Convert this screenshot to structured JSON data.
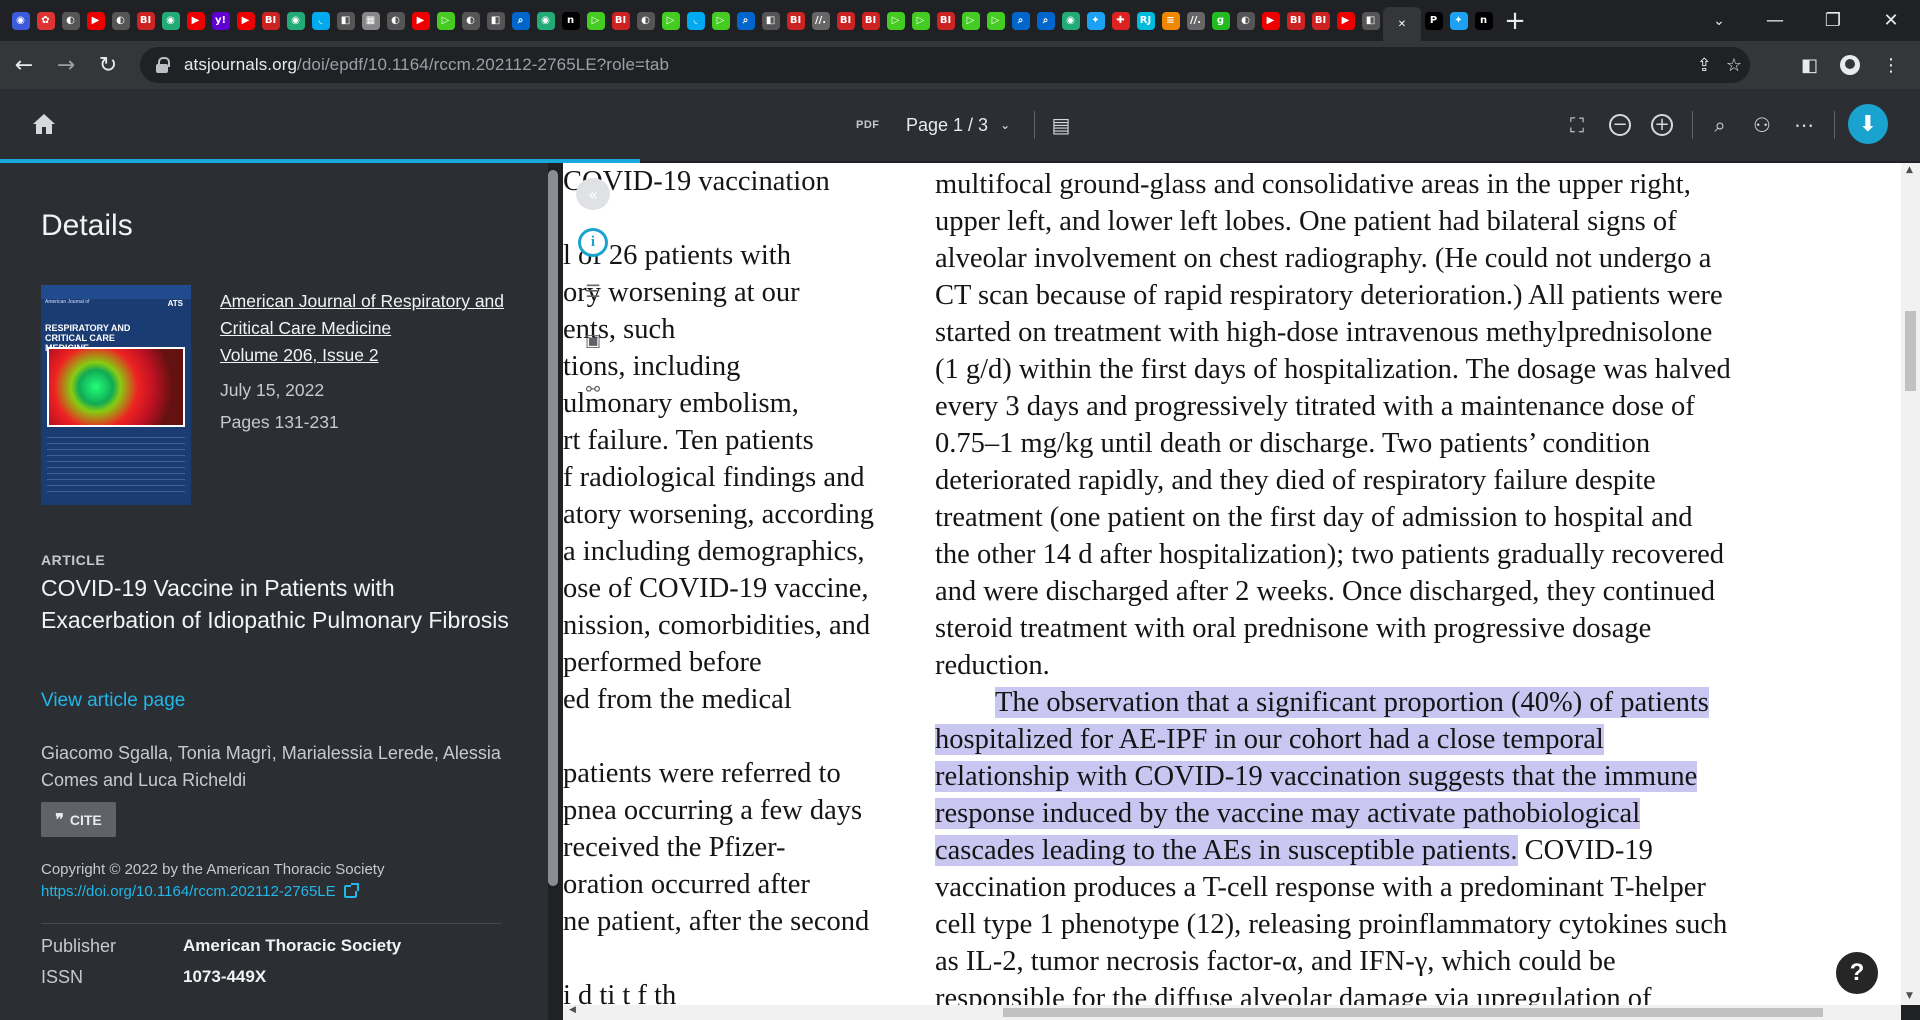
{
  "browser": {
    "tabs": [
      {
        "color": "#3b5bdb",
        "glyph": "◉"
      },
      {
        "color": "#d33",
        "glyph": "✿"
      },
      {
        "color": "#555",
        "glyph": "◐"
      },
      {
        "color": "#e00",
        "glyph": "▶"
      },
      {
        "color": "#555",
        "glyph": "◐"
      },
      {
        "color": "#c22",
        "glyph": "BI"
      },
      {
        "color": "#2a7",
        "glyph": "◉"
      },
      {
        "color": "#e00",
        "glyph": "▶"
      },
      {
        "color": "#6001d2",
        "glyph": "y!"
      },
      {
        "color": "#e00",
        "glyph": "▶"
      },
      {
        "color": "#c22",
        "glyph": "BI"
      },
      {
        "color": "#2a7",
        "glyph": "◉"
      },
      {
        "color": "#0ae",
        "glyph": "◟"
      },
      {
        "color": "#555",
        "glyph": "◧"
      },
      {
        "color": "#888",
        "glyph": "▦"
      },
      {
        "color": "#555",
        "glyph": "◐"
      },
      {
        "color": "#e00",
        "glyph": "▶"
      },
      {
        "color": "#4c2",
        "glyph": "▷"
      },
      {
        "color": "#555",
        "glyph": "◐"
      },
      {
        "color": "#555",
        "glyph": "◧"
      },
      {
        "color": "#06c",
        "glyph": "⌕"
      },
      {
        "color": "#2a7",
        "glyph": "◉"
      },
      {
        "color": "#000",
        "glyph": "n"
      },
      {
        "color": "#4c2",
        "glyph": "▷"
      },
      {
        "color": "#c22",
        "glyph": "BI"
      },
      {
        "color": "#555",
        "glyph": "◐"
      },
      {
        "color": "#4c2",
        "glyph": "▷"
      },
      {
        "color": "#0ae",
        "glyph": "◟"
      },
      {
        "color": "#4c2",
        "glyph": "▷"
      },
      {
        "color": "#06c",
        "glyph": "⌕"
      },
      {
        "color": "#555",
        "glyph": "◧"
      },
      {
        "color": "#c22",
        "glyph": "BI"
      },
      {
        "color": "#666",
        "glyph": "//."
      },
      {
        "color": "#c22",
        "glyph": "BI"
      },
      {
        "color": "#c22",
        "glyph": "BI"
      },
      {
        "color": "#4c2",
        "glyph": "▷"
      },
      {
        "color": "#4c2",
        "glyph": "▷"
      },
      {
        "color": "#c22",
        "glyph": "BI"
      },
      {
        "color": "#4c2",
        "glyph": "▷"
      },
      {
        "color": "#4c2",
        "glyph": "▷"
      },
      {
        "color": "#06c",
        "glyph": "⌕"
      },
      {
        "color": "#06c",
        "glyph": "⌕"
      },
      {
        "color": "#2a7",
        "glyph": "◉"
      },
      {
        "color": "#1da1f2",
        "glyph": "✦"
      },
      {
        "color": "#d22",
        "glyph": "✚"
      },
      {
        "color": "#0bd",
        "glyph": "RJ"
      },
      {
        "color": "#e80",
        "glyph": "≡"
      },
      {
        "color": "#666",
        "glyph": "//."
      },
      {
        "color": "#2b2",
        "glyph": "g"
      },
      {
        "color": "#555",
        "glyph": "◐"
      },
      {
        "color": "#e00",
        "glyph": "▶"
      },
      {
        "color": "#c22",
        "glyph": "BI"
      },
      {
        "color": "#c22",
        "glyph": "BI"
      },
      {
        "color": "#e00",
        "glyph": "▶"
      },
      {
        "color": "#555",
        "glyph": "◧"
      }
    ],
    "active_tab_close": "✕",
    "tabs_after": [
      {
        "color": "#000",
        "glyph": "P"
      },
      {
        "color": "#1da1f2",
        "glyph": "✦"
      },
      {
        "color": "#000",
        "glyph": "n"
      }
    ],
    "new_tab": "+",
    "url_domain": "atsjournals.org",
    "url_path": "/doi/epdf/10.1164/rccm.202112-2765LE?role=tab"
  },
  "viewer": {
    "pdf_tag": "PDF",
    "page_indicator": "Page 1 / 3",
    "accent": "#1aa3cf"
  },
  "details": {
    "heading": "Details",
    "cover": {
      "small_title": "American Journal of",
      "title_line1": "RESPIRATORY AND",
      "title_line2": "CRITICAL CARE MEDICINE",
      "logo": "ATS"
    },
    "journal_name_line1": "American Journal of Respiratory and",
    "journal_name_line2": "Critical Care Medicine",
    "volume": "Volume 206, Issue 2",
    "date": "July 15, 2022",
    "pages": "Pages  131-231",
    "article_label": "ARTICLE",
    "article_title": "COVID-19 Vaccine in Patients with Exacerbation of Idiopathic Pulmonary Fibrosis",
    "view_article": "View article page",
    "authors": "Giacomo Sgalla, Tonia Magrì, Marialessia Lerede, Alessia Comes and Luca Richeldi",
    "cite_label": "CITE",
    "copyright": "Copyright © 2022 by the American Thoracic Society",
    "doi_url": "https://doi.org/10.1164/rccm.202112-2765LE",
    "publisher_key": "Publisher",
    "publisher_value": "American Thoracic Society",
    "issn_key": "ISSN",
    "issn_value": "1073-449X"
  },
  "pdf": {
    "left_column": [
      "COVID-19 vaccination",
      "",
      "l of 26 patients with",
      "ory worsening at our",
      "ents, such",
      "tions, including",
      "ulmonary embolism,",
      "rt failure. Ten patients",
      "f radiological findings and",
      "atory worsening, according",
      "a including demographics,",
      "ose of COVID-19 vaccine,",
      "nission, comorbidities, and",
      "performed before",
      "ed from the medical",
      "",
      "patients were referred to",
      "pnea occurring a few days",
      "received the Pfizer-",
      "oration occurred after",
      "ne patient, after the second",
      "",
      "i  d  ti  t  f  th"
    ],
    "right_column": [
      "multifocal ground-glass and consolidative areas in the upper right,",
      "upper left, and lower left lobes. One patient had bilateral signs of",
      "alveolar involvement on chest radiography. (He could not undergo a",
      "CT scan because of rapid respiratory deterioration.) All patients were",
      "started on treatment with high-dose intravenous methylprednisolone",
      "(1 g/d) within the first days of hospitalization. The dosage was halved",
      "every 3 days and progressively titrated with a maintenance dose of",
      "0.75–1 mg/kg until death or discharge. Two patients’ condition",
      "deteriorated rapidly, and they died of respiratory failure despite",
      "treatment (one patient on the first day of admission to hospital and",
      "the other 14 d after hospitalization); two patients gradually recovered",
      "and were discharged after 2 weeks. Once discharged, they continued",
      "steroid treatment with oral prednisone with progressive dosage",
      "reduction."
    ],
    "highlighted": [
      "The observation that a significant proportion (40%) of patients",
      "hospitalized for AE-IPF in our cohort had a close temporal",
      "relationship with COVID-19 vaccination suggests that the immune",
      "response induced by the vaccine may activate pathobiological",
      "cascades leading to the AEs in susceptible patients."
    ],
    "after_highlight": " COVID-19",
    "right_rest": [
      "vaccination produces a T-cell response with a predominant T-helper",
      "cell type 1 phenotype (12), releasing proinflammatory cytokines such",
      "as IL-2, tumor necrosis factor-α, and IFN-γ, which could be",
      "responsible for the diffuse alveolar damage via upregulation of"
    ],
    "highlight_color": "#c9c7f2"
  },
  "help_label": "?"
}
